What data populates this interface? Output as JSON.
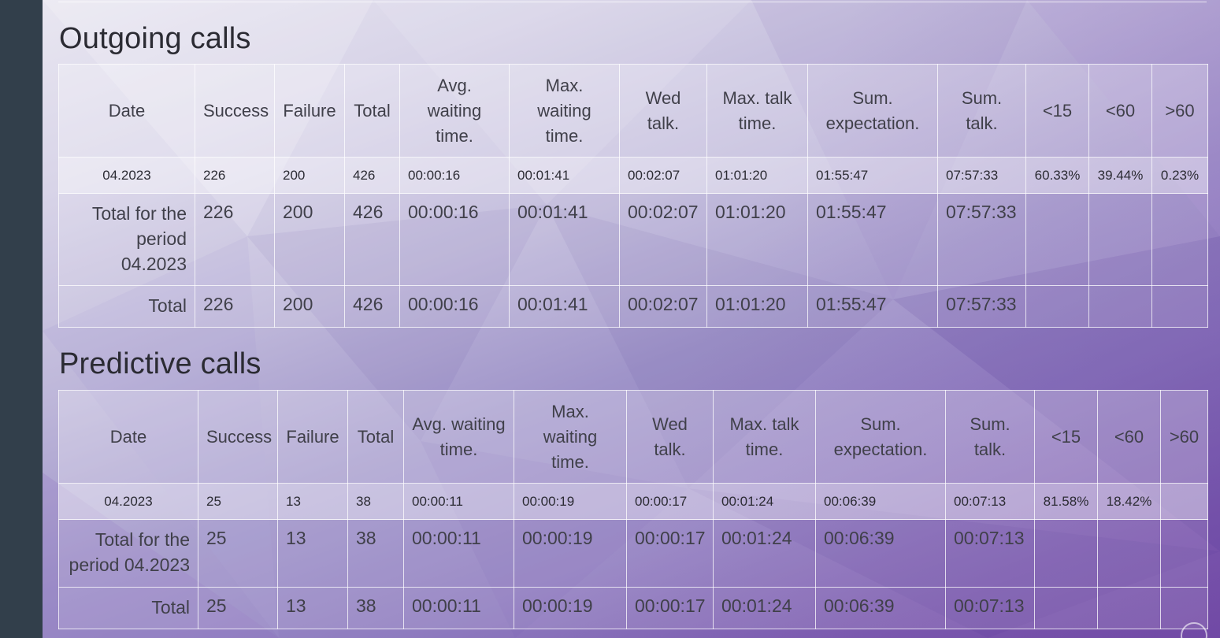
{
  "outgoing": {
    "title": "Outgoing calls",
    "columns": [
      "Date",
      "Success",
      "Failure",
      "Total",
      "Avg. waiting time.",
      "Max. waiting time.",
      "Wed talk.",
      "Max. talk time.",
      "Sum. expectation.",
      "Sum. talk.",
      "<15",
      "<60",
      ">60"
    ],
    "month_row": {
      "date": "04.2023",
      "success": "226",
      "failure": "200",
      "total": "426",
      "avg_wait": "00:00:16",
      "max_wait": "00:01:41",
      "wed_talk": "00:02:07",
      "max_talk": "01:01:20",
      "sum_expect": "01:55:47",
      "sum_talk": "07:57:33",
      "lt15": "60.33%",
      "lt60": "39.44%",
      "gt60": "0.23%"
    },
    "period_row": {
      "label": "Total for the period 04.2023",
      "success": "226",
      "failure": "200",
      "total": "426",
      "avg_wait": "00:00:16",
      "max_wait": "00:01:41",
      "wed_talk": "00:02:07",
      "max_talk": "01:01:20",
      "sum_expect": "01:55:47",
      "sum_talk": "07:57:33"
    },
    "total_row": {
      "label": "Total",
      "success": "226",
      "failure": "200",
      "total": "426",
      "avg_wait": "00:00:16",
      "max_wait": "00:01:41",
      "wed_talk": "00:02:07",
      "max_talk": "01:01:20",
      "sum_expect": "01:55:47",
      "sum_talk": "07:57:33"
    }
  },
  "predictive": {
    "title": "Predictive calls",
    "columns": [
      "Date",
      "Success",
      "Failure",
      "Total",
      "Avg. waiting time.",
      "Max. waiting time.",
      "Wed talk.",
      "Max. talk time.",
      "Sum. expectation.",
      "Sum. talk.",
      "<15",
      "<60",
      ">60"
    ],
    "month_row": {
      "date": "04.2023",
      "success": "25",
      "failure": "13",
      "total": "38",
      "avg_wait": "00:00:11",
      "max_wait": "00:00:19",
      "wed_talk": "00:00:17",
      "max_talk": "00:01:24",
      "sum_expect": "00:06:39",
      "sum_talk": "00:07:13",
      "lt15": "81.58%",
      "lt60": "18.42%",
      "gt60": ""
    },
    "period_row": {
      "label": "Total for the period 04.2023",
      "success": "25",
      "failure": "13",
      "total": "38",
      "avg_wait": "00:00:11",
      "max_wait": "00:00:19",
      "wed_talk": "00:00:17",
      "max_talk": "00:01:24",
      "sum_expect": "00:06:39",
      "sum_talk": "00:07:13"
    },
    "total_row": {
      "label": "Total",
      "success": "25",
      "failure": "13",
      "total": "38",
      "avg_wait": "00:00:11",
      "max_wait": "00:00:19",
      "wed_talk": "00:00:17",
      "max_talk": "00:01:24",
      "sum_expect": "00:06:39",
      "sum_talk": "00:07:13"
    }
  }
}
